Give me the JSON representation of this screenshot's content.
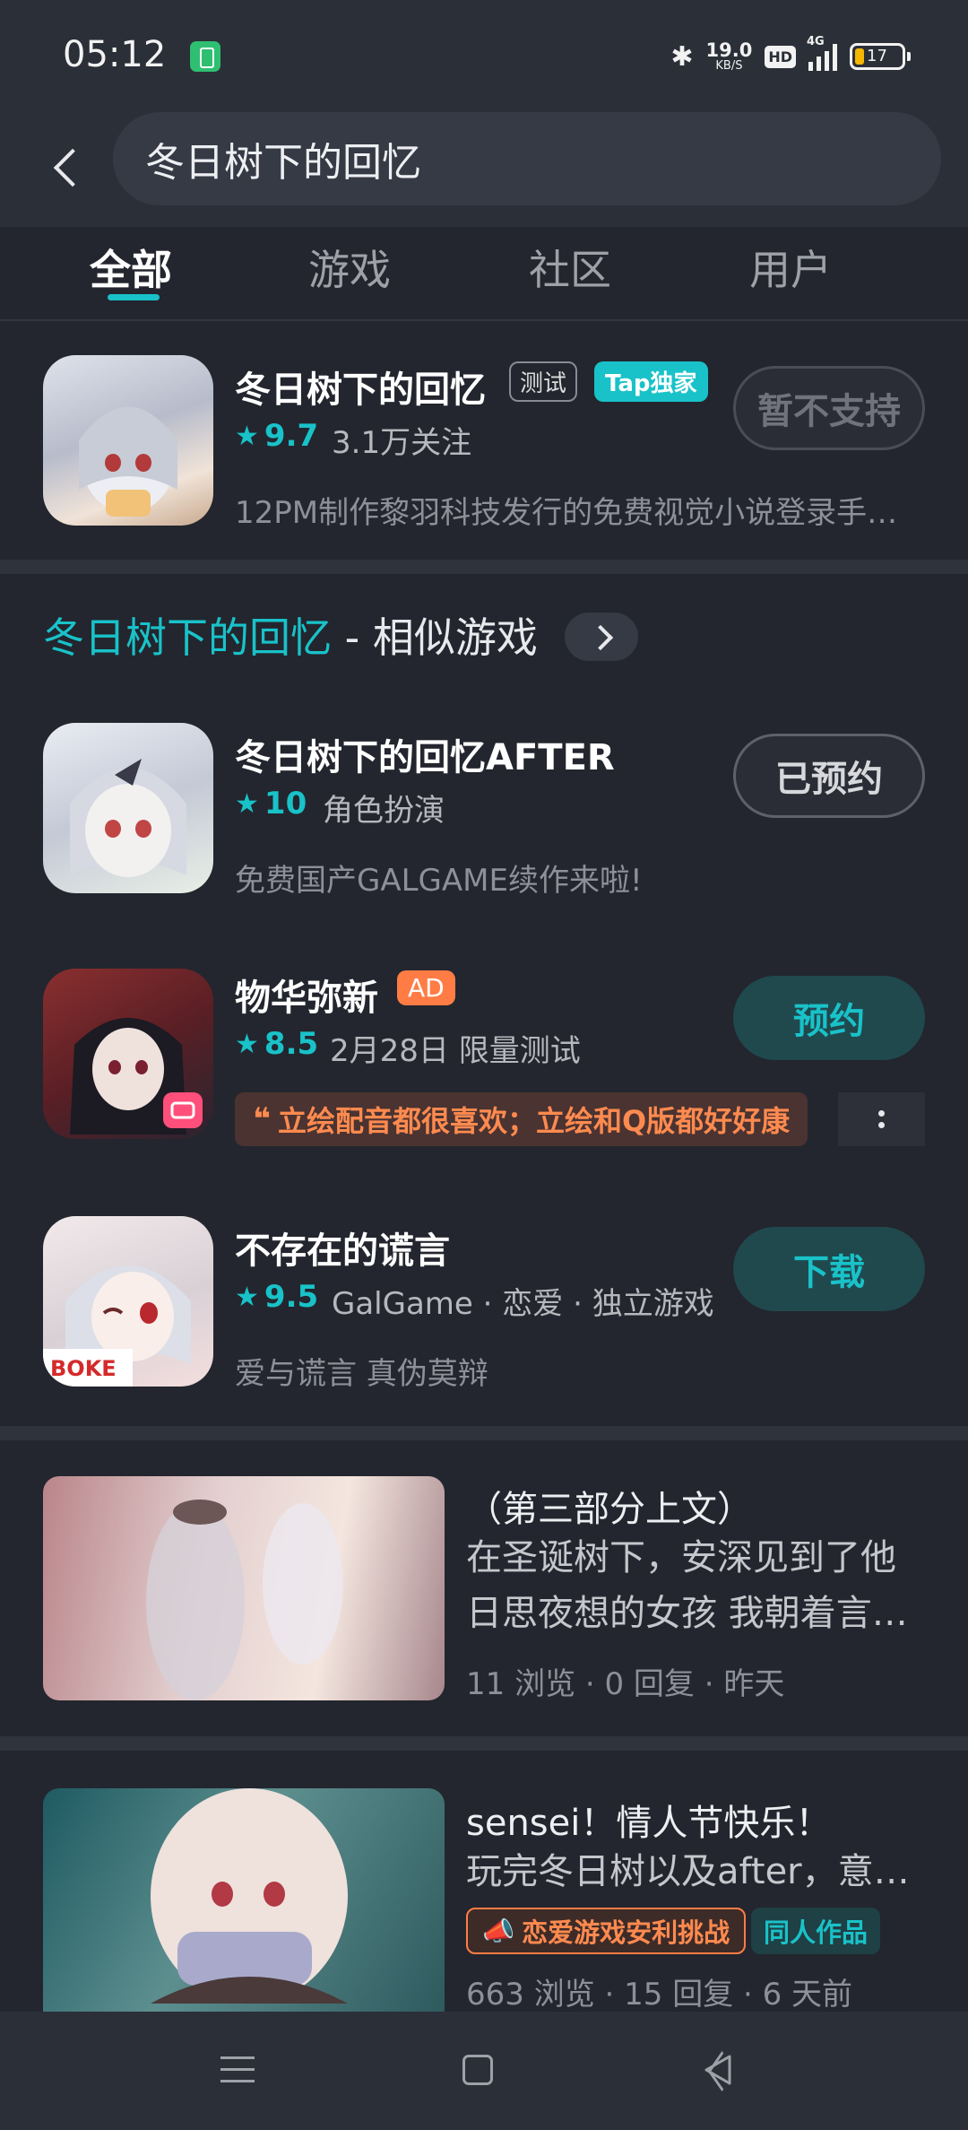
{
  "status_bar": {
    "time": "05:12",
    "net_speed": "19.0",
    "net_unit": "KB/S",
    "hd": "HD",
    "network": "4G",
    "battery": "17"
  },
  "search": {
    "query": "冬日树下的回忆"
  },
  "tabs": [
    {
      "label": "全部",
      "active": true
    },
    {
      "label": "游戏"
    },
    {
      "label": "社区"
    },
    {
      "label": "用户"
    }
  ],
  "top_result": {
    "title": "冬日树下的回忆",
    "tag_test": "测试",
    "tag_exclusive": "Tap独家",
    "rating": "9.7",
    "followers": "3.1万关注",
    "description": "12PM制作黎羽科技发行的免费视觉小说登录手…",
    "button": "暂不支持"
  },
  "similar": {
    "highlight": "冬日树下的回忆",
    "suffix": " - 相似游戏"
  },
  "games": [
    {
      "title": "冬日树下的回忆AFTER",
      "rating": "10",
      "meta": "角色扮演",
      "description": "免费国产GALGAME续作来啦!",
      "button": "已预约"
    },
    {
      "title": "物华弥新",
      "ad": "AD",
      "rating": "8.5",
      "meta": "2月28日 限量测试",
      "quote": "立绘配音都很喜欢；立绘和Q版都好好康",
      "button": "预约"
    },
    {
      "title": "不存在的谎言",
      "rating": "9.5",
      "meta": "GalGame · 恋爱 · 独立游戏",
      "description": "爱与谎言 真伪莫辩",
      "button": "下载"
    }
  ],
  "posts": [
    {
      "title": "（第三部分上文）",
      "line1": "在圣诞树下，安深见到了他",
      "line2": "日思夜想的女孩 我朝着言…",
      "stats": "11 浏览 · 0 回复 · 昨天"
    },
    {
      "title": "sensei！情人节快乐！",
      "line1": "玩完冬日树以及after，意…",
      "event_tag": "恋爱游戏安利挑战",
      "fan_tag": "同人作品",
      "stats": "663 浏览 · 15 回复 · 6 天前"
    }
  ],
  "colors": {
    "accent": "#19c2c9",
    "background": "#23262e",
    "ad": "#ff7d45"
  }
}
